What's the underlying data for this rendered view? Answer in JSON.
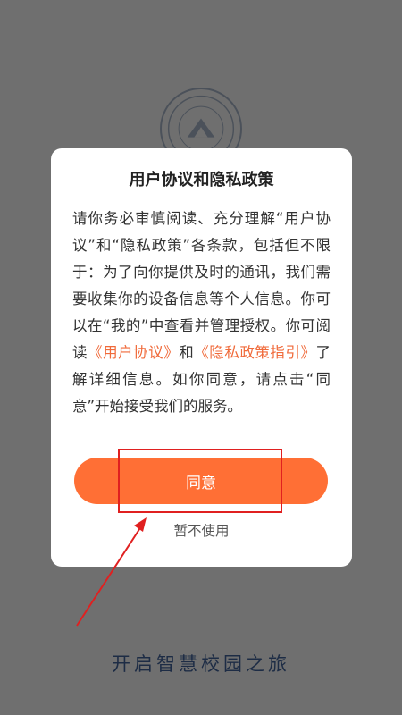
{
  "background": {
    "slogan": "开启智慧校园之旅",
    "logo": "university-seal-icon"
  },
  "dialog": {
    "title": "用户协议和隐私政策",
    "body": {
      "part1": "请你务必审慎阅读、充分理解“用户协议”和“隐私政策”各条款，包括但不限于：为了向你提供及时的通讯，我们需要收集你的设备信息等个人信息。你可以在“我的”中查看并管理授权。你可阅读",
      "link_user_agreement": "《用户协议》",
      "part2": "和",
      "link_privacy_guide": "《隐私政策指引》",
      "part3": "了解详细信息。如你同意，请点击“同意”开始接受我们的服务。"
    },
    "agree_label": "同意",
    "decline_label": "暂不使用"
  },
  "annotation": {
    "box_color": "#e02020",
    "arrow_color": "#e02020"
  },
  "colors": {
    "accent": "#ff6f35",
    "link": "#f06a3a",
    "overlay": "#6f6f6f"
  }
}
